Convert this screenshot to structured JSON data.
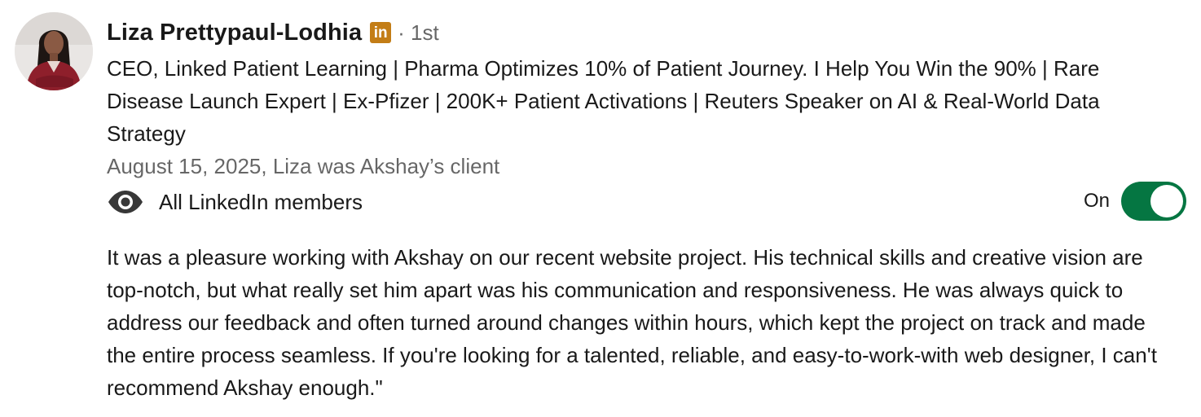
{
  "recommendation": {
    "author": {
      "name": "Liza Prettypaul-Lodhia",
      "badge_icon": "linkedin-icon",
      "badge_text": "in",
      "connection_degree": "· 1st",
      "headline": "CEO, Linked Patient Learning | Pharma Optimizes 10% of Patient Journey. I Help You Win the 90% | Rare Disease Launch Expert | Ex-Pfizer | 200K+ Patient Activations | Reuters Speaker on AI & Real-World Data Strategy"
    },
    "meta": "August 15, 2025, Liza was Akshay’s client",
    "visibility": {
      "icon": "eye-icon",
      "label": "All LinkedIn members"
    },
    "toggle": {
      "label": "On",
      "state": "on",
      "color": "#057642"
    },
    "text": "It was a pleasure working with Akshay on our recent website project. His technical skills and creative vision are top-notch, but what really set him apart was his communication and responsiveness. He was always quick to address our feedback and often turned around changes within hours, which kept the project on track and made the entire process seamless. If you're looking for a talented, reliable, and easy-to-work-with web designer, I can't recommend Akshay enough.\""
  },
  "colors": {
    "badge": "#c37d16",
    "toggle_on": "#057642",
    "muted_text": "rgba(0,0,0,0.6)"
  }
}
